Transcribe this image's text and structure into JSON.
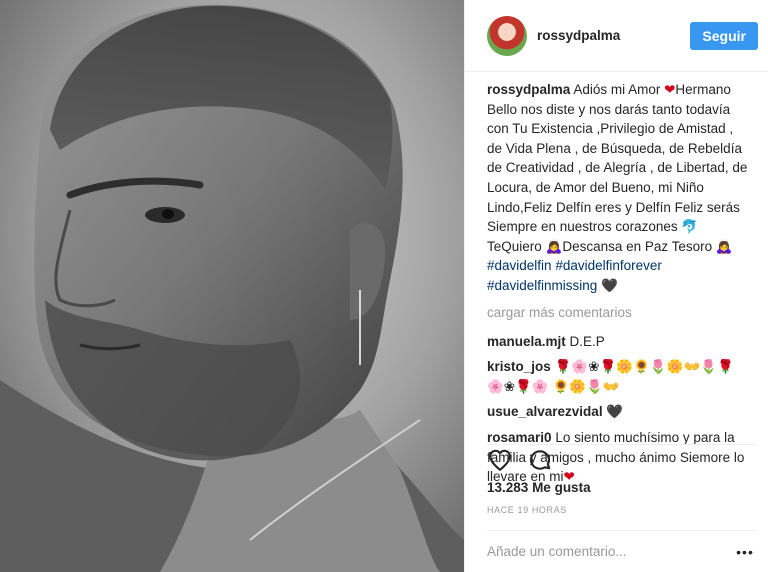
{
  "post": {
    "header": {
      "username": "rossydpalma",
      "follow_label": "Seguir"
    },
    "caption": {
      "username": "rossydpalma",
      "text": "Adiós mi Amor",
      "heart": "❤",
      "body": "Hermano Bello nos diste y nos darás tanto todavía con Tu Existencia ,Privilegio de Amistad , de Vida Plena , de Búsqueda, de Rebeldía de Creatividad , de Alegría , de Libertad, de Locura, de Amor del Bueno, mi Niño Lindo,Feliz Delfín eres y Delfín Feliz serás Siempre en nuestros corazones 🐬TeQuiero 🙇‍♀️Descansa en Paz Tesoro 🙇‍♀️",
      "tag1": "#davidelfin",
      "tag2": "#davidelfinforever",
      "tag3": "#davidelfinmissing",
      "end_heart": "🖤"
    },
    "load_more_label": "cargar más comentarios",
    "comments": [
      {
        "user": "manuela.mjt",
        "text": "D.E.P"
      },
      {
        "user": "kristo_jos",
        "text": "🌹🌸❀🌹🌼🌻🌷🌼👐🌷🌹🌸❀🌹🌸 🌻🌼🌷👐"
      },
      {
        "user": "usue_alvarezvidal",
        "text": "🖤"
      },
      {
        "user": "rosamari0",
        "text": "Lo siento muchísimo y para la familia y amigos , mucho ánimo Siemore lo llevare en mi",
        "heart": "❤"
      }
    ],
    "likes_count": "13.283",
    "likes_label": "Me gusta",
    "time_ago": "Hace 19 horas",
    "add_comment_placeholder": "Añade un comentario...",
    "icons": {
      "like": "heart-outline-icon",
      "comment": "speech-bubble-icon",
      "more": "ellipsis-icon"
    }
  }
}
